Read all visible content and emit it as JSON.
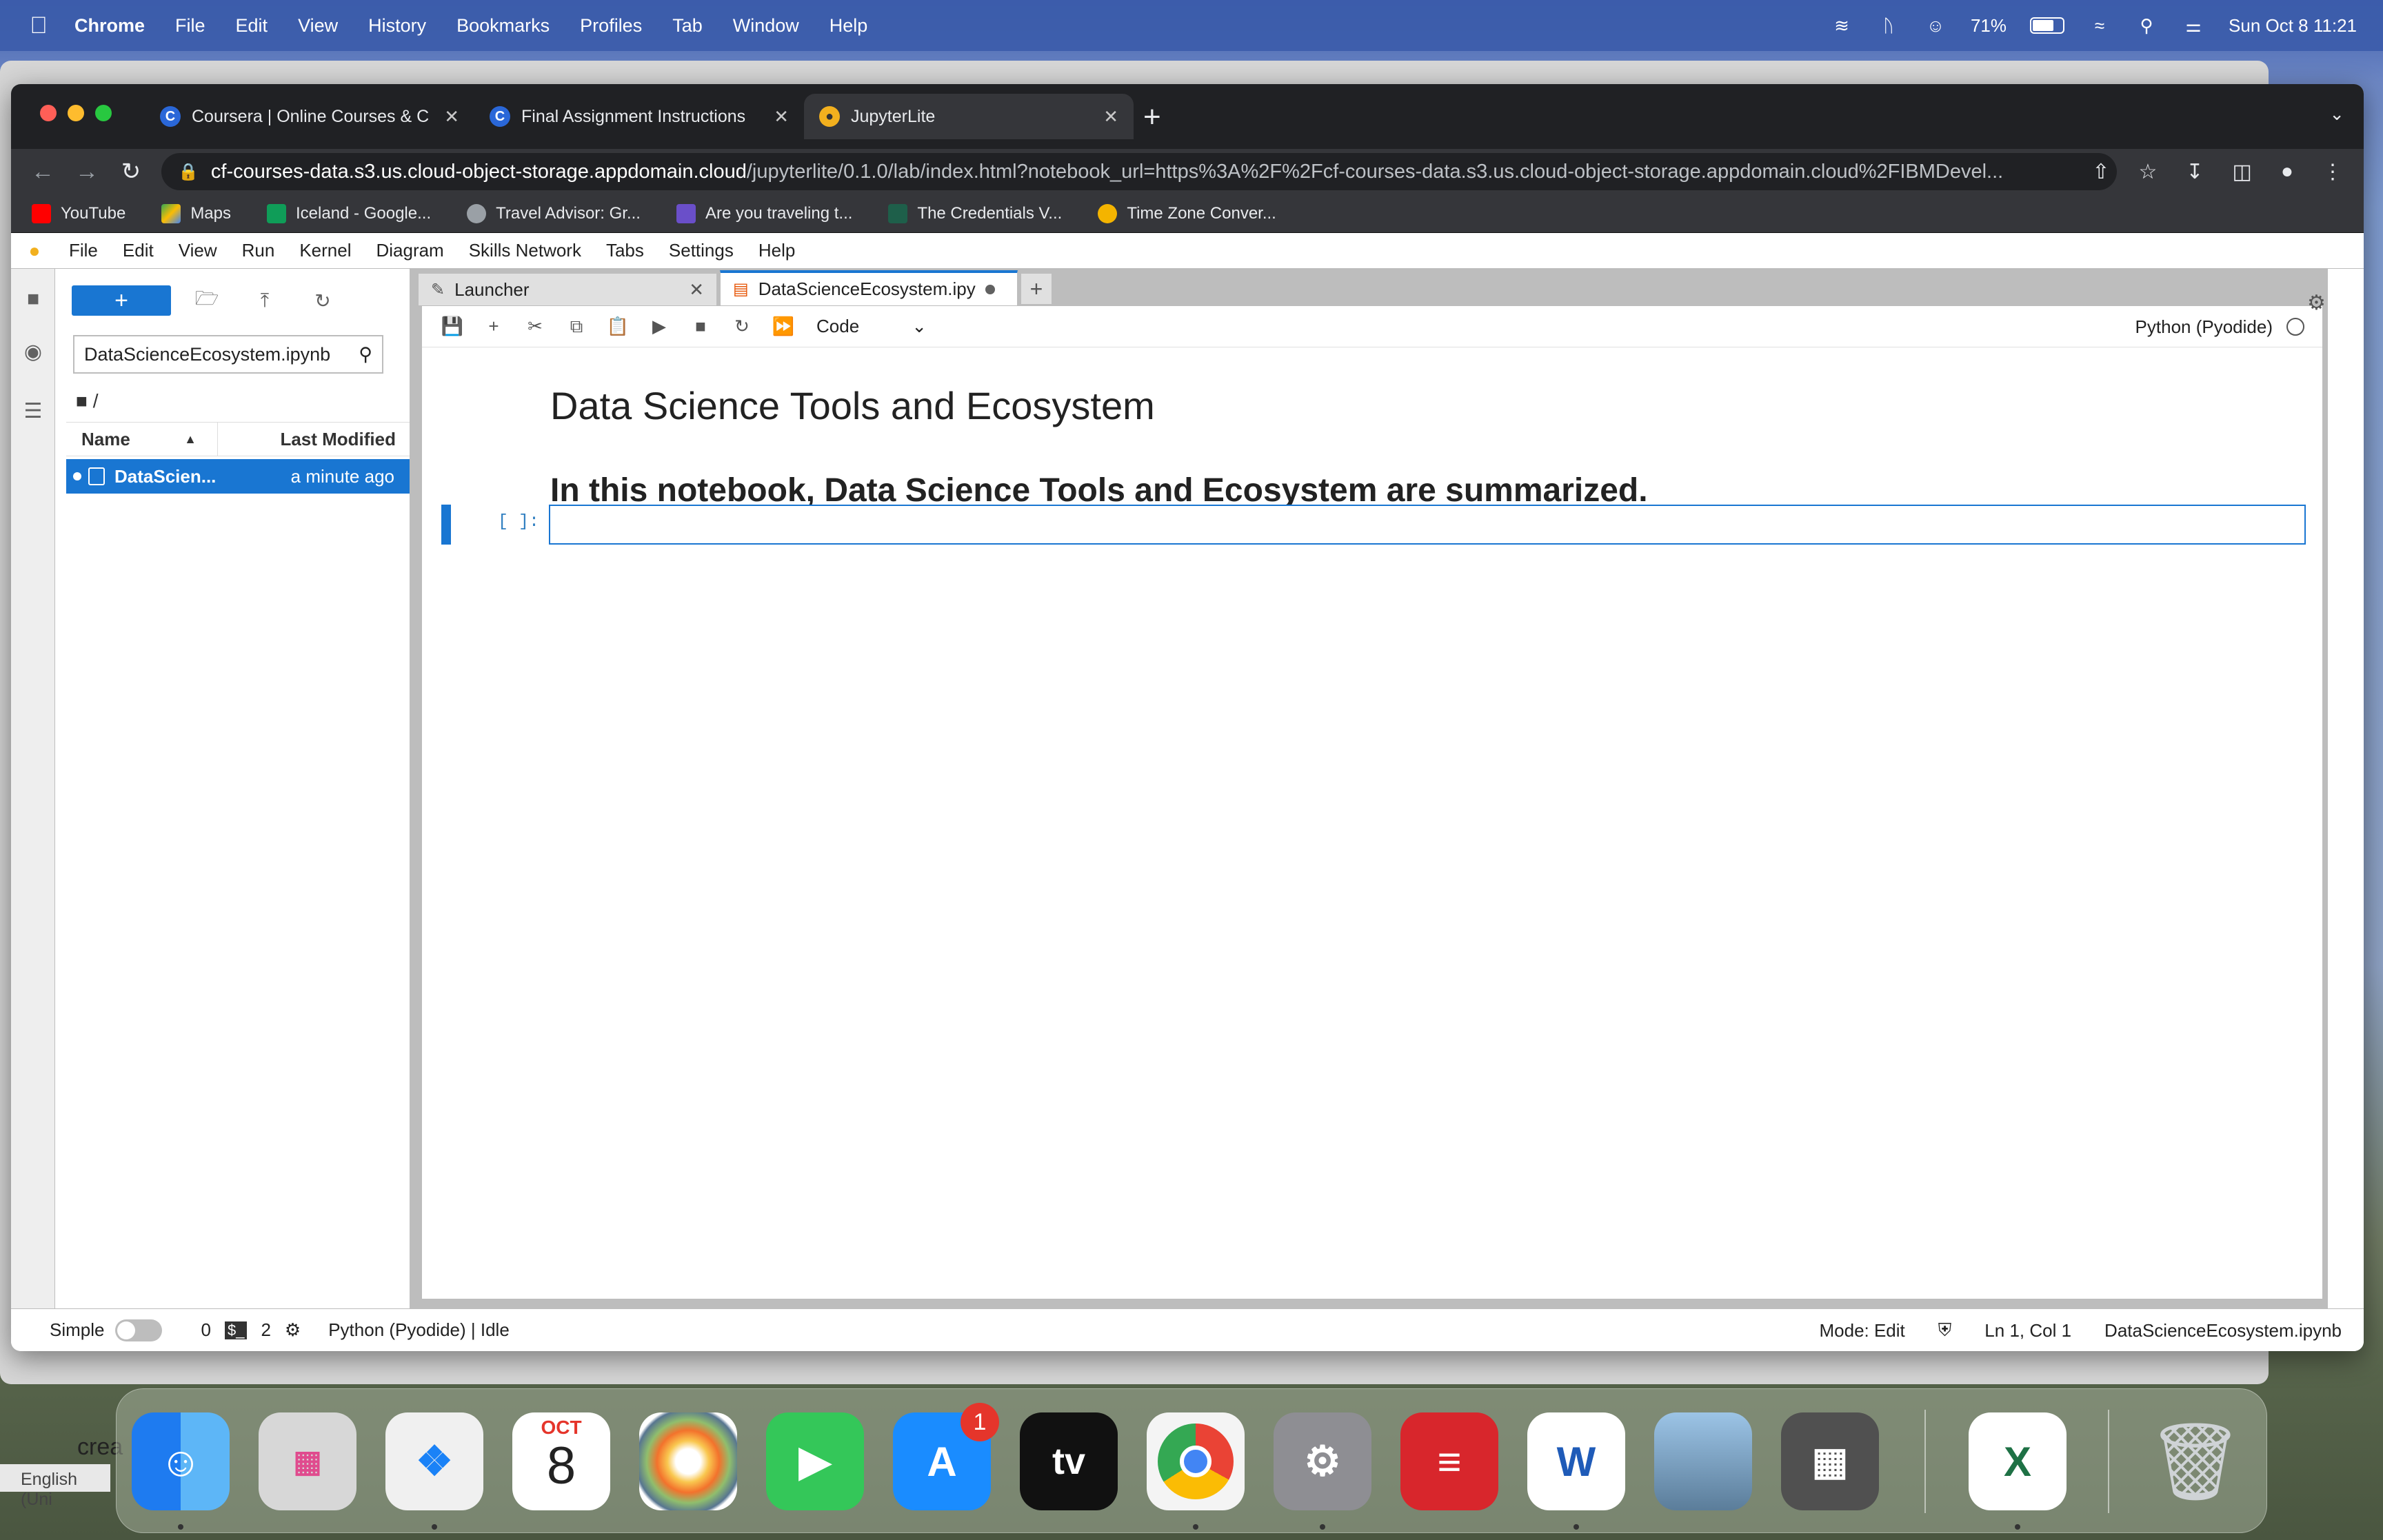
{
  "mac_menubar": {
    "app": "Chrome",
    "items": [
      "File",
      "Edit",
      "View",
      "History",
      "Bookmarks",
      "Profiles",
      "Tab",
      "Window",
      "Help"
    ],
    "battery": "71%",
    "battery_level": 0.71,
    "datetime": "Sun Oct 8  11:21"
  },
  "browser": {
    "tabs": [
      {
        "title": "Coursera | Online Courses & C",
        "favicon": "C",
        "active": false
      },
      {
        "title": "Final Assignment Instructions",
        "favicon": "C",
        "active": false
      },
      {
        "title": "JupyterLite",
        "favicon": "jupyterlite-icon",
        "active": true
      }
    ],
    "url_host": "cf-courses-data.s3.us.cloud-object-storage.appdomain.cloud",
    "url_path": "/jupyterlite/0.1.0/lab/index.html?notebook_url=https%3A%2F%2Fcf-courses-data.s3.us.cloud-object-storage.appdomain.cloud%2FIBMDevel...",
    "bookmarks": [
      {
        "label": "YouTube",
        "color": "#ff0000"
      },
      {
        "label": "Maps",
        "color": "#34a853"
      },
      {
        "label": "Iceland - Google...",
        "color": "#0f9d58"
      },
      {
        "label": "Travel Advisor: Gr...",
        "color": "#9aa0a6"
      },
      {
        "label": "Are you traveling t...",
        "color": "#6a4fc9"
      },
      {
        "label": "The Credentials V...",
        "color": "#1e5f4a"
      },
      {
        "label": "Time Zone Conver...",
        "color": "#f4b400"
      }
    ]
  },
  "jupyter": {
    "menu": [
      "File",
      "Edit",
      "View",
      "Run",
      "Kernel",
      "Diagram",
      "Skills Network",
      "Tabs",
      "Settings",
      "Help"
    ],
    "file_browser": {
      "new_label": "+",
      "search_value": "DataScienceEcosystem.ipynb",
      "breadcrumb": "/",
      "col_name": "Name",
      "col_modified": "Last Modified",
      "files": [
        {
          "name": "DataScien...",
          "modified": "a minute ago"
        }
      ]
    },
    "doc_tabs": [
      {
        "label": "Launcher"
      },
      {
        "label": "DataScienceEcosystem.ipy"
      }
    ],
    "cell_type": "Code",
    "kernel": "Python (Pyodide)",
    "notebook": {
      "heading1": "Data Science Tools and Ecosystem",
      "heading2": "In this notebook, Data Science Tools and Ecosystem are summarized.",
      "prompt": "[ ]:"
    },
    "status": {
      "mode_label": "Simple",
      "count1": "0",
      "count2": "2",
      "kernel_status": "Python (Pyodide) | Idle",
      "mode": "Mode: Edit",
      "position": "Ln 1, Col 1",
      "filename": "DataScienceEcosystem.ipynb"
    }
  },
  "background": {
    "text1": "crea",
    "text2": "English (Uni"
  },
  "dock": {
    "calendar_month": "OCT",
    "calendar_day": "8",
    "appstore_badge": "1",
    "tv_label": "tv"
  }
}
